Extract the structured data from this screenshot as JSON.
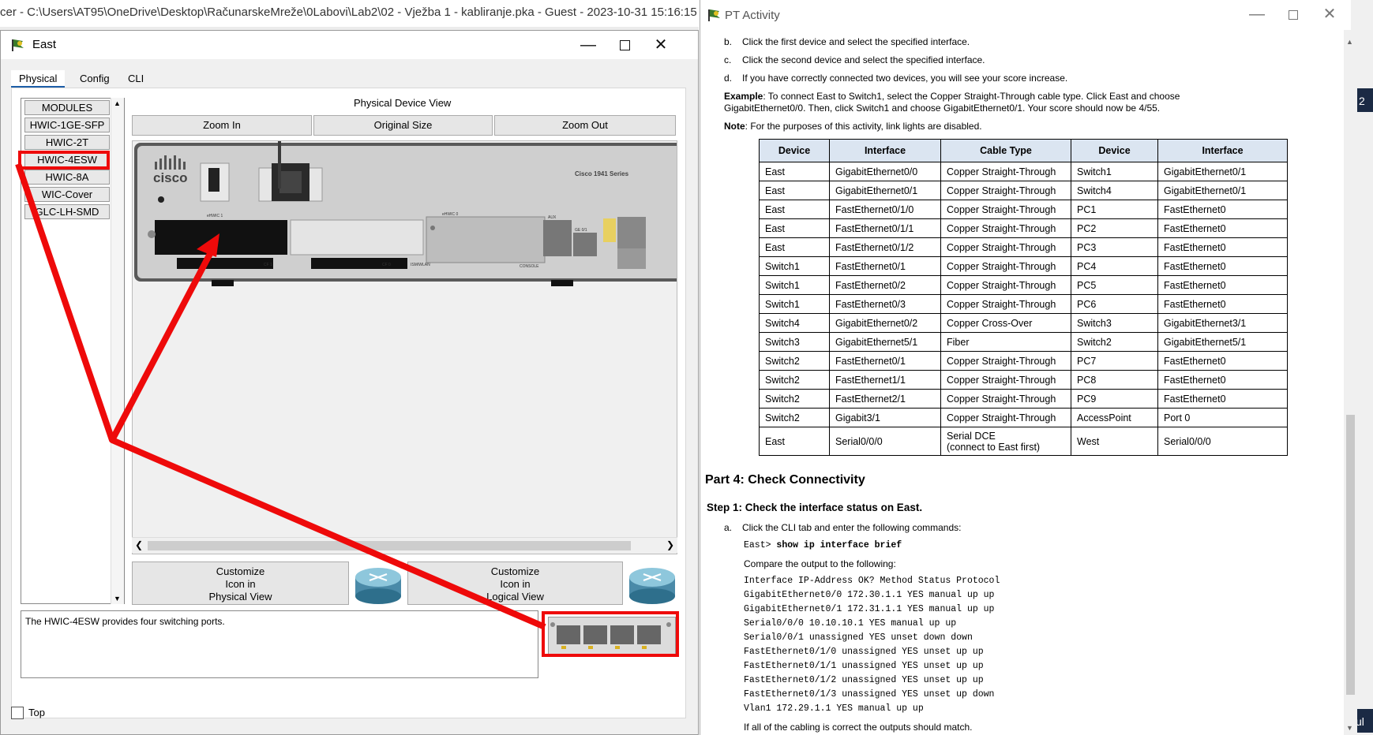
{
  "background_window": {
    "title": "cer - C:\\Users\\AT95\\OneDrive\\Desktop\\RačunarskeMreže\\0Labovi\\Lab2\\02 - Vježba 1 - kabliranje.pka - Guest - 2023-10-31 15:16:15",
    "right_edge_text_1": "2",
    "right_edge_text_2": "ul"
  },
  "east_window": {
    "title": "East",
    "tabs": [
      "Physical",
      "Config",
      "CLI"
    ],
    "modules_header": "MODULES",
    "modules": [
      "HWIC-1GE-SFP",
      "HWIC-2T",
      "HWIC-4ESW",
      "HWIC-8A",
      "WIC-Cover",
      "GLC-LH-SMD"
    ],
    "selected_module": "HWIC-4ESW",
    "physical_view_label": "Physical Device View",
    "zoom_in": "Zoom In",
    "original_size": "Original Size",
    "zoom_out": "Zoom Out",
    "router_brand": "cisco",
    "router_model": "Cisco 1941 Series",
    "slot_label_1": "eHWIC 1",
    "slot_label_0": "eHWIC 0",
    "port_labels": {
      "cf1": "CF 1",
      "cf0": "CF 0",
      "ism": "ISM/WLAN",
      "aux": "AUX",
      "ge01": "GE 0/1",
      "console": "CONSOLE"
    },
    "customize_physical": [
      "Customize",
      "Icon in",
      "Physical View"
    ],
    "customize_logical": [
      "Customize",
      "Icon in",
      "Logical View"
    ],
    "description": "The HWIC-4ESW provides four switching ports.",
    "top_checkbox_label": "Top",
    "annotation_color": "#ee0a0a"
  },
  "pt_activity": {
    "title": "PT Activity",
    "steps": [
      {
        "letter": "b.",
        "text": "Click the first device and select the specified interface."
      },
      {
        "letter": "c.",
        "text": "Click the second device and select the specified interface."
      },
      {
        "letter": "d.",
        "text": "If you have correctly connected two devices, you will see your score increase."
      }
    ],
    "example_label": "Example",
    "example_line1": ": To connect East to Switch1, select the Copper Straight-Through cable type. Click East and choose",
    "example_line2": "GigabitEthernet0/0. Then, click Switch1 and choose GigabitEthernet0/1. Your score should now be 4/55.",
    "note_label": "Note",
    "note_text": ": For the purposes of this activity, link lights are disabled.",
    "table": {
      "headers": [
        "Device",
        "Interface",
        "Cable Type",
        "Device",
        "Interface"
      ],
      "rows": [
        [
          "East",
          "GigabitEthernet0/0",
          "Copper Straight-Through",
          "Switch1",
          "GigabitEthernet0/1"
        ],
        [
          "East",
          "GigabitEthernet0/1",
          "Copper Straight-Through",
          "Switch4",
          "GigabitEthernet0/1"
        ],
        [
          "East",
          "FastEthernet0/1/0",
          "Copper Straight-Through",
          "PC1",
          "FastEthernet0"
        ],
        [
          "East",
          "FastEthernet0/1/1",
          "Copper Straight-Through",
          "PC2",
          "FastEthernet0"
        ],
        [
          "East",
          "FastEthernet0/1/2",
          "Copper Straight-Through",
          "PC3",
          "FastEthernet0"
        ],
        [
          "Switch1",
          "FastEthernet0/1",
          "Copper Straight-Through",
          "PC4",
          "FastEthernet0"
        ],
        [
          "Switch1",
          "FastEthernet0/2",
          "Copper Straight-Through",
          "PC5",
          "FastEthernet0"
        ],
        [
          "Switch1",
          "FastEthernet0/3",
          "Copper Straight-Through",
          "PC6",
          "FastEthernet0"
        ],
        [
          "Switch4",
          "GigabitEthernet0/2",
          "Copper Cross-Over",
          "Switch3",
          "GigabitEthernet3/1"
        ],
        [
          "Switch3",
          "GigabitEthernet5/1",
          "Fiber",
          "Switch2",
          "GigabitEthernet5/1"
        ],
        [
          "Switch2",
          "FastEthernet0/1",
          "Copper Straight-Through",
          "PC7",
          "FastEthernet0"
        ],
        [
          "Switch2",
          "FastEthernet1/1",
          "Copper Straight-Through",
          "PC8",
          "FastEthernet0"
        ],
        [
          "Switch2",
          "FastEthernet2/1",
          "Copper Straight-Through",
          "PC9",
          "FastEthernet0"
        ],
        [
          "Switch2",
          "Gigabit3/1",
          "Copper Straight-Through",
          "AccessPoint",
          "Port 0"
        ],
        [
          "East",
          "Serial0/0/0",
          "Serial DCE\n(connect to East first)",
          "West",
          "Serial0/0/0"
        ]
      ]
    },
    "part_heading": "Part 4: Check Connectivity",
    "step_heading": "Step 1: Check the interface status on East.",
    "step_a_letter": "a.",
    "step_a_text": "Click the CLI tab and enter the following commands:",
    "prompt": "East>",
    "command": "show ip interface brief",
    "compare_text": "Compare the output to the following:",
    "output_lines": [
      "Interface IP-Address OK? Method Status Protocol",
      "GigabitEthernet0/0 172.30.1.1 YES manual up up",
      "GigabitEthernet0/1 172.31.1.1 YES manual up up",
      "Serial0/0/0 10.10.10.1 YES manual up up",
      "Serial0/0/1 unassigned YES unset down down",
      "FastEthernet0/1/0 unassigned YES unset up up",
      "FastEthernet0/1/1 unassigned YES unset up up",
      "FastEthernet0/1/2 unassigned YES unset up up",
      "FastEthernet0/1/3 unassigned YES unset up down",
      "Vlan1 172.29.1.1 YES manual up up"
    ],
    "final_text": "If all of the cabling is correct the outputs should match."
  }
}
